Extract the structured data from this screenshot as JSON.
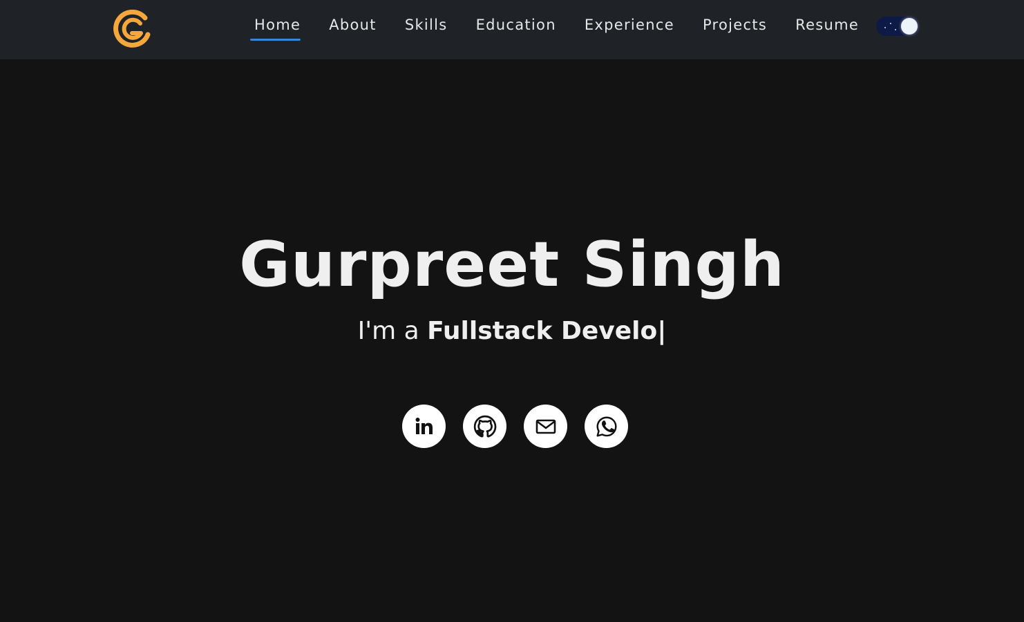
{
  "navbar": {
    "logo_icon": "g-logo-icon",
    "links": [
      {
        "label": "Home",
        "active": true
      },
      {
        "label": "About"
      },
      {
        "label": "Skills"
      },
      {
        "label": "Education"
      },
      {
        "label": "Experience"
      },
      {
        "label": "Projects"
      },
      {
        "label": "Resume"
      }
    ],
    "theme_toggle": {
      "state": "dark",
      "icon": "moon-toggle-icon"
    }
  },
  "hero": {
    "name": "Gurpreet Singh",
    "prefix": "I'm a ",
    "role_typed": "Fullstack Develo|"
  },
  "socials": [
    {
      "icon": "linkedin-icon"
    },
    {
      "icon": "github-icon"
    },
    {
      "icon": "mail-icon"
    },
    {
      "icon": "whatsapp-icon"
    }
  ],
  "colors": {
    "background": "#131313",
    "navbar": "#1f2226",
    "accent_underline": "#3a86d0",
    "logo": "#f5a73b",
    "text": "#efefef"
  }
}
